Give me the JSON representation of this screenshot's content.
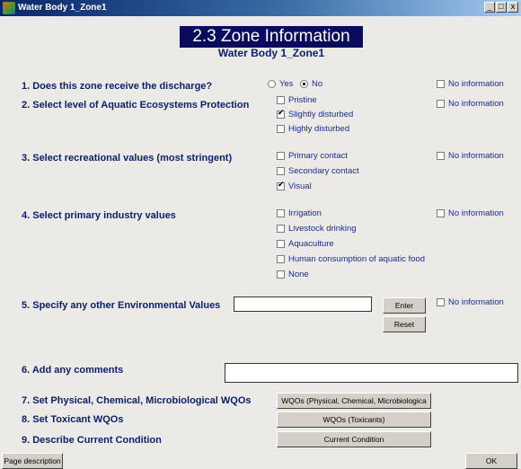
{
  "window": {
    "title": "Water Body 1_Zone1",
    "controls": [
      "_",
      "□",
      "x"
    ]
  },
  "header": {
    "title": "2.3 Zone Information",
    "subtitle": "Water Body 1_Zone1"
  },
  "questions": {
    "q1": {
      "label": "1. Does this zone receive the discharge?",
      "yes": "Yes",
      "no": "No",
      "selected": "No"
    },
    "q2": {
      "label": "2. Select level of Aquatic Ecosystems Protection",
      "options": [
        "Pristine",
        "Slightly disturbed",
        "Highly disturbed"
      ],
      "checked": [
        false,
        true,
        false
      ]
    },
    "q3": {
      "label": "3. Select recreational values (most stringent)",
      "options": [
        "Primary contact",
        "Secondary contact",
        "Visual"
      ],
      "checked": [
        false,
        false,
        true
      ]
    },
    "q4": {
      "label": "4. Select primary industry values",
      "options": [
        "Irrigation",
        "Livestock drinking",
        "Aquaculture",
        "Human consumption of aquatic food",
        "None"
      ],
      "checked": [
        false,
        false,
        false,
        false,
        false
      ]
    },
    "q5": {
      "label": "5. Specify any other Environmental Values",
      "value": "",
      "enter_label": "Enter",
      "reset_label": "Reset"
    },
    "q6": {
      "label": "6. Add any comments",
      "value": ""
    },
    "q7": {
      "label": "7. Set Physical, Chemical, Microbiological WQOs",
      "button_label": "WQOs (Physical, Chemical, Microbiologica"
    },
    "q8": {
      "label": "8. Set Toxicant WQOs",
      "button_label": "WQOs (Toxicants)"
    },
    "q9": {
      "label": "9. Describe Current Condition",
      "button_label": "Current Condition"
    }
  },
  "no_information_label": "No information",
  "footer": {
    "page_description_label": "Page description",
    "ok_label": "OK"
  }
}
